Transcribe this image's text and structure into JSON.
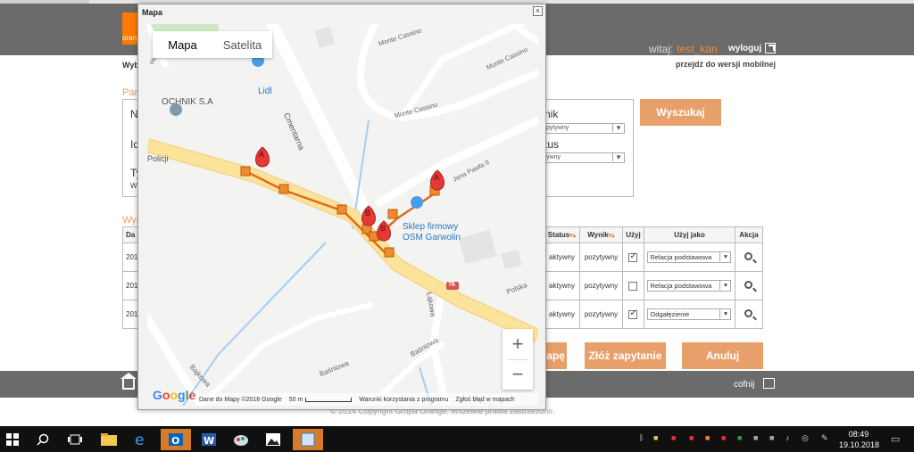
{
  "header": {
    "greeting": "witaj:",
    "username": "test_kan",
    "logout": "wyloguj",
    "mobile_link": "przejdź do wersji mobilnej",
    "logo_text": "oran"
  },
  "bg_labels": {
    "wyb": "Wyb",
    "par": "Par",
    "wys": "Wys",
    "left_na": "Na",
    "left_id": "Id",
    "left_ty": "Ty",
    "left_w": "W"
  },
  "filters": {
    "wynik_label": "nik",
    "wynik_value": "pytywny",
    "status_label": "tus",
    "status_value": "ywny",
    "search_button": "Wyszukaj"
  },
  "table": {
    "headers": [
      "Da",
      "Status",
      "Wynik",
      "Użyj",
      "Użyj jako",
      "Akcja"
    ],
    "rows": [
      {
        "date": "2014",
        "status": "aktywny",
        "result": "pozytywny",
        "use": true,
        "use_as": "Relacja podstawowa"
      },
      {
        "date": "2014",
        "status": "aktywny",
        "result": "pozytywny",
        "use": false,
        "use_as": "Relacja podstawowa"
      },
      {
        "date": "2014",
        "status": "aktywny",
        "result": "pozytywny",
        "use": true,
        "use_as": "Odgałęzienie"
      }
    ]
  },
  "buttons": {
    "map_partial": "apę",
    "submit": "Złóż zapytanie",
    "cancel": "Anuluj"
  },
  "footer": {
    "back": "cofnij",
    "copyright": "© 2014 Copyright Grupa Orange. Wszelkie prawa zastrzeżone."
  },
  "dialog": {
    "title": "Mapa",
    "close": "×",
    "map_type_map": "Mapa",
    "map_type_satellite": "Satelita",
    "zoom_in": "+",
    "zoom_out": "−",
    "labels": {
      "lidl": "Lidl",
      "ochnik": "OCHNIK S.A",
      "policji": "Policji",
      "cmentarna": "Cmentarna",
      "monte1": "Monte Cassino",
      "monte2": "Monte Cassino",
      "monte3": "Monte Cassino",
      "jana_pawla": "Jana Pawła II",
      "sklep1": "Sklep firmowy",
      "sklep2": "OSM Garwolin",
      "road76": "76",
      "polska": "Polska",
      "lakowa": "Łąkowa",
      "basniowa1": "Baśniowa",
      "basniowa2": "Baśniowa",
      "bajkowa": "Bajkowa",
      "ows": "ows"
    },
    "markers": {
      "a": "A",
      "b": "B"
    },
    "attribution": {
      "data": "Dane do Mapy ©2018 Google",
      "scale": "50 m",
      "terms": "Warunki korzystania z programu",
      "report": "Zgłoś błąd w mapach",
      "google": "Google"
    }
  },
  "taskbar": {
    "time": "08:49",
    "date": "19.10.2018"
  },
  "colors": {
    "accent": "#e8a06a",
    "header": "#6b6b6b",
    "marker": "#e53935",
    "route": "#e06a1a",
    "main_road": "#fbe39a"
  }
}
